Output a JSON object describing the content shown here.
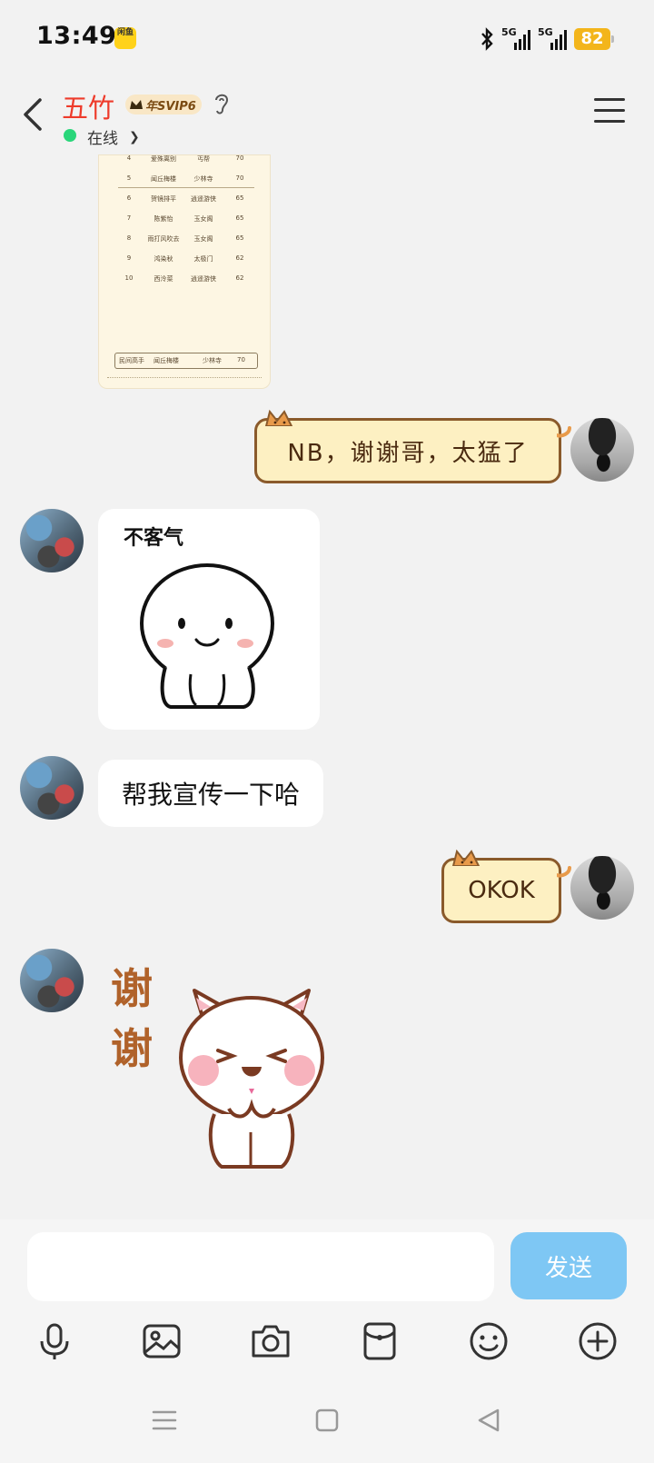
{
  "status_bar": {
    "time": "13:49",
    "app_icon_text": "闲鱼",
    "network_1": "5G",
    "network_2": "5G",
    "battery": "82"
  },
  "header": {
    "contact_name": "五竹",
    "vip_badge": "年SVIP6",
    "online_status": "在线",
    "online_dot_color": "#2ad67a",
    "name_color": "#ee3b2b"
  },
  "leaderboard_image": {
    "rows": [
      {
        "rank": "4",
        "name": "爱殊离别",
        "sect": "丐帮",
        "score": "70"
      },
      {
        "rank": "5",
        "name": "闻丘梅楼",
        "sect": "少林寺",
        "score": "70"
      },
      {
        "rank": "6",
        "name": "贺镜排平",
        "sect": "逍遥游侠",
        "score": "65"
      },
      {
        "rank": "7",
        "name": "陈紫怡",
        "sect": "玉女阁",
        "score": "65"
      },
      {
        "rank": "8",
        "name": "雨打风吹去",
        "sect": "玉女阁",
        "score": "65"
      },
      {
        "rank": "9",
        "name": "鸿染秋",
        "sect": "太极门",
        "score": "62"
      },
      {
        "rank": "10",
        "name": "西泠菜",
        "sect": "逍遥游侠",
        "score": "62"
      }
    ],
    "footer": {
      "label": "民间高手",
      "name": "闻丘梅楼",
      "sect": "少林寺",
      "score": "70"
    }
  },
  "messages": {
    "outgoing_1": "NB，谢谢哥，太猛了",
    "sticker_1_caption": "不客气",
    "incoming_text": "帮我宣传一下哈",
    "outgoing_2": "OKOK",
    "sticker_2_text_1": "谢",
    "sticker_2_text_2": "谢"
  },
  "input": {
    "placeholder": "",
    "send_label": "发送",
    "send_color": "#7ec7f4"
  },
  "toolbar_icons": [
    "microphone-icon",
    "image-icon",
    "camera-icon",
    "red-packet-icon",
    "emoji-icon",
    "plus-icon"
  ],
  "nav_icons": [
    "recent-apps-icon",
    "home-icon",
    "back-nav-icon"
  ]
}
